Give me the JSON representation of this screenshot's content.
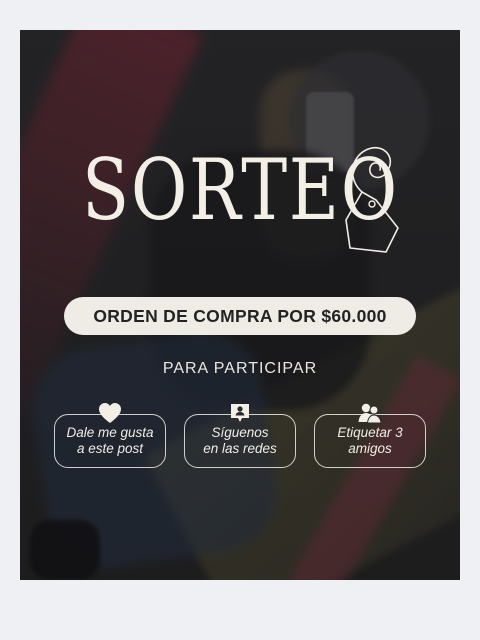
{
  "post": {
    "title": "SORTEO",
    "price_pill": "ORDEN DE COMPRA POR $60.000",
    "subtitle": "PARA PARTICIPAR",
    "steps": [
      {
        "icon": "heart-icon",
        "line1": "Dale me gusta",
        "line2": "a este post"
      },
      {
        "icon": "user-chat-icon",
        "line1": "Síguenos",
        "line2": "en las redes"
      },
      {
        "icon": "users-icon",
        "line1": "Etiquetar 3",
        "line2": "amigos"
      }
    ]
  },
  "colors": {
    "text_light": "#f4efe6",
    "pill_bg": "#efebe5",
    "pill_text": "#232323",
    "page_bg": "#eef0f4"
  }
}
